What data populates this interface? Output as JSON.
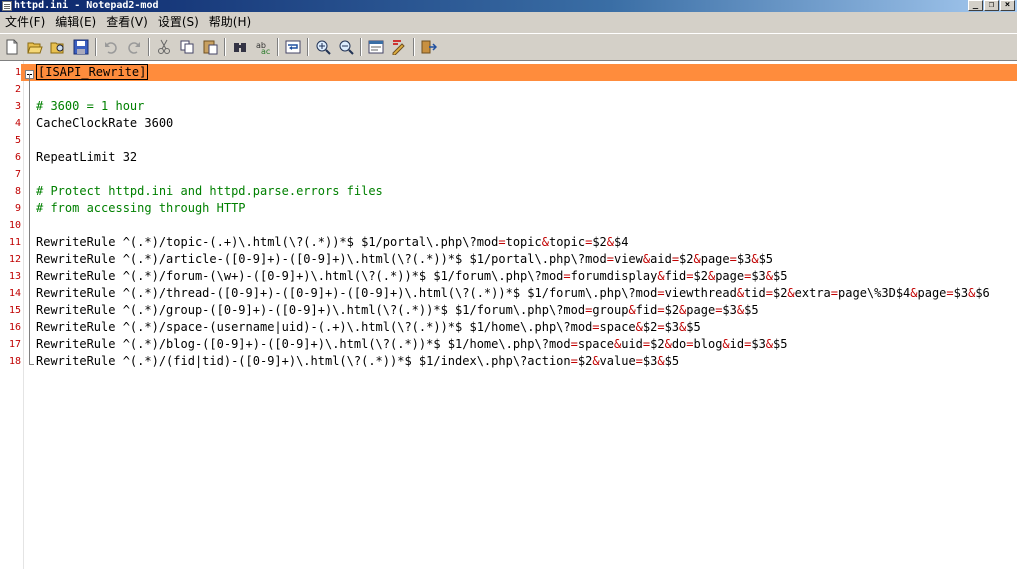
{
  "window": {
    "title": "httpd.ini - Notepad2-mod"
  },
  "menu": [
    "文件(F)",
    "编辑(E)",
    "查看(V)",
    "设置(S)",
    "帮助(H)"
  ],
  "toolbar": [
    "new-icon",
    "open-icon",
    "browse-icon",
    "save-icon",
    "undo-icon",
    "redo-icon",
    "cut-icon",
    "copy-icon",
    "paste-icon",
    "find-icon",
    "replace-icon",
    "wordwrap-icon",
    "zoom-in-icon",
    "zoom-out-icon",
    "scheme-icon",
    "customize-schemes-icon",
    "exit-icon"
  ],
  "editor": {
    "current_line": 1,
    "lines": [
      {
        "n": "1",
        "text": "[ISAPI_Rewrite]",
        "kind": "section"
      },
      {
        "n": "2",
        "text": "",
        "kind": "plain"
      },
      {
        "n": "3",
        "text": "# 3600 = 1 hour",
        "kind": "comment"
      },
      {
        "n": "4",
        "text": "CacheClockRate 3600",
        "kind": "plain"
      },
      {
        "n": "5",
        "text": "",
        "kind": "plain"
      },
      {
        "n": "6",
        "text": "RepeatLimit 32",
        "kind": "plain"
      },
      {
        "n": "7",
        "text": "",
        "kind": "plain"
      },
      {
        "n": "8",
        "text": "# Protect httpd.ini and httpd.parse.errors files",
        "kind": "comment"
      },
      {
        "n": "9",
        "text": "# from accessing through HTTP",
        "kind": "comment"
      },
      {
        "n": "10",
        "text": "",
        "kind": "plain"
      },
      {
        "n": "11",
        "text": "RewriteRule ^(.*)/topic-(.+)\\.html(\\?(.*))*$ $1/portal\\.php\\?mod=topic&topic=$2&$4",
        "kind": "rule"
      },
      {
        "n": "12",
        "text": "RewriteRule ^(.*)/article-([0-9]+)-([0-9]+)\\.html(\\?(.*))*$ $1/portal\\.php\\?mod=view&aid=$2&page=$3&$5",
        "kind": "rule"
      },
      {
        "n": "13",
        "text": "RewriteRule ^(.*)/forum-(\\w+)-([0-9]+)\\.html(\\?(.*))*$ $1/forum\\.php\\?mod=forumdisplay&fid=$2&page=$3&$5",
        "kind": "rule"
      },
      {
        "n": "14",
        "text": "RewriteRule ^(.*)/thread-([0-9]+)-([0-9]+)-([0-9]+)\\.html(\\?(.*))*$ $1/forum\\.php\\?mod=viewthread&tid=$2&extra=page\\%3D$4&page=$3&$6",
        "kind": "rule"
      },
      {
        "n": "15",
        "text": "RewriteRule ^(.*)/group-([0-9]+)-([0-9]+)\\.html(\\?(.*))*$ $1/forum\\.php\\?mod=group&fid=$2&page=$3&$5",
        "kind": "rule"
      },
      {
        "n": "16",
        "text": "RewriteRule ^(.*)/space-(username|uid)-(.+)\\.html(\\?(.*))*$ $1/home\\.php\\?mod=space&$2=$3&$5",
        "kind": "rule"
      },
      {
        "n": "17",
        "text": "RewriteRule ^(.*)/blog-([0-9]+)-([0-9]+)\\.html(\\?(.*))*$ $1/home\\.php\\?mod=space&uid=$2&do=blog&id=$3&$5",
        "kind": "rule"
      },
      {
        "n": "18",
        "text": "RewriteRule ^(.*)/(fid|tid)-([0-9]+)\\.html(\\?(.*))*$ $1/index\\.php\\?action=$2&value=$3&$5",
        "kind": "rule"
      }
    ]
  }
}
